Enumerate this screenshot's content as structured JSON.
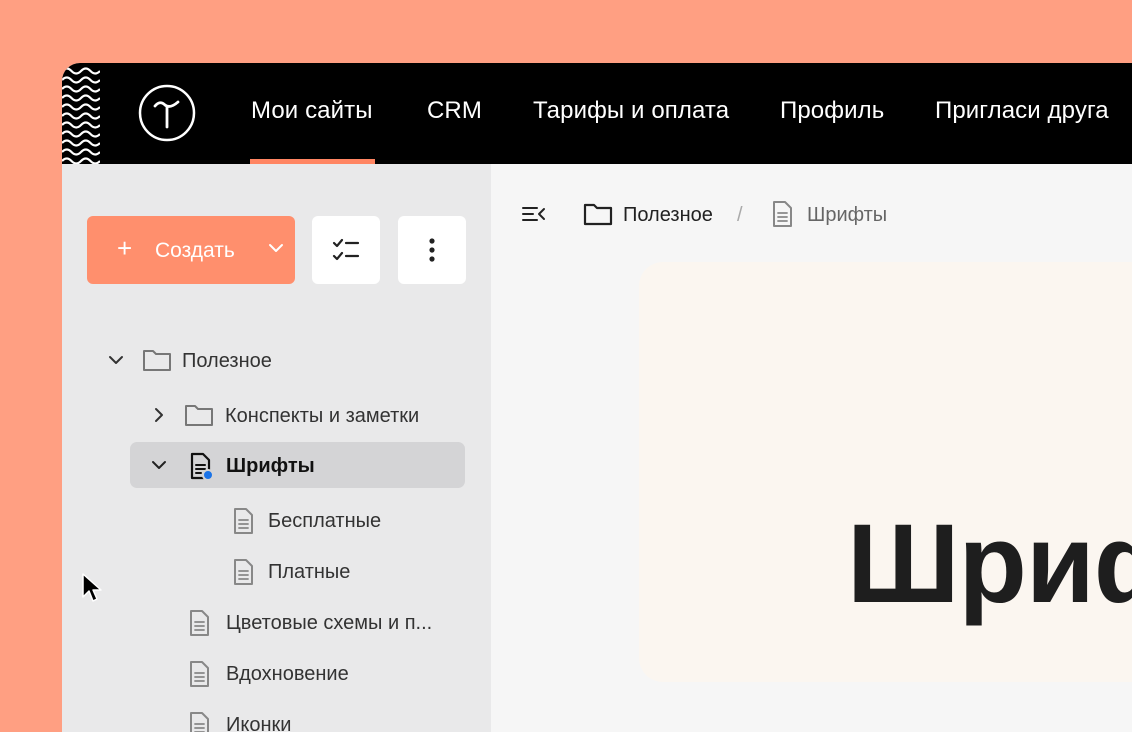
{
  "nav": {
    "items": [
      "Мои сайты",
      "CRM",
      "Тарифы и оплата",
      "Профиль",
      "Пригласи друга"
    ],
    "active_index": 0
  },
  "sidebar": {
    "create_label": "Создать",
    "tree": {
      "useful": "Полезное",
      "notes": "Конспекты и заметки",
      "fonts": "Шрифты",
      "free": "Бесплатные",
      "paid": "Платные",
      "colors": "Цветовые схемы и п...",
      "inspiration": "Вдохновение",
      "icons": "Иконки"
    }
  },
  "breadcrumb": {
    "folder": "Полезное",
    "separator": "/",
    "page": "Шрифты"
  },
  "main": {
    "title": "Шриф"
  },
  "colors": {
    "accent": "#ff8f6d",
    "background": "#ff9f82",
    "topbar": "#000000",
    "status_dot": "#1a73e8"
  }
}
